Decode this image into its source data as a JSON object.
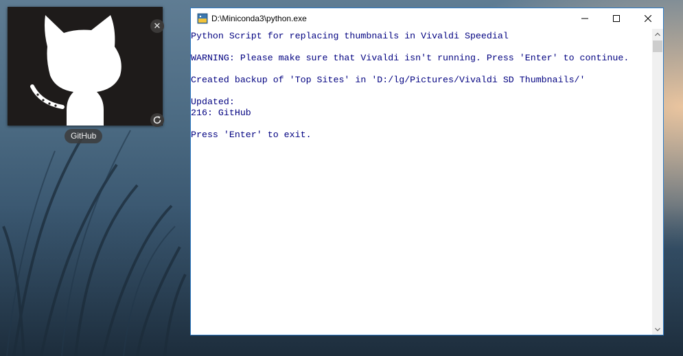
{
  "speed_dial": {
    "label": "GitHub",
    "close_glyph": "✕",
    "tile_background": "#1e1b1a"
  },
  "window": {
    "title": "D:\\Miniconda3\\python.exe",
    "icon": "python-icon",
    "border_color": "#2b79c4"
  },
  "console": {
    "text_color": "#000080",
    "lines": [
      "Python Script for replacing thumbnails in Vivaldi Speedial",
      "",
      "WARNING: Please make sure that Vivaldi isn't running. Press 'Enter' to continue.",
      "",
      "Created backup of 'Top Sites' in 'D:/lg/Pictures/Vivaldi SD Thumbnails/'",
      "",
      "Updated:",
      "216: GitHub",
      "",
      "Press 'Enter' to exit."
    ]
  }
}
